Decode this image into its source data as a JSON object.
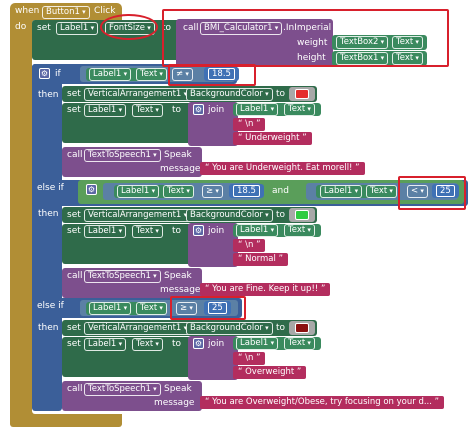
{
  "event": {
    "when": "when",
    "component": "Button1",
    "event": "Click",
    "do": "do"
  },
  "top_set": {
    "set": "set",
    "component": "Label1",
    "property": "FontSize",
    "to": "to",
    "call": "call",
    "method": "BMI_Calculator1",
    "method_name": ".InImperial",
    "weight_label": "weight",
    "height_label": "height",
    "weight_comp": "TextBox2",
    "weight_prop": "Text",
    "height_comp": "TextBox1",
    "height_prop": "Text"
  },
  "if1": {
    "if": "if",
    "then": "then",
    "comp": "Label1",
    "prop": "Text",
    "op": "≠",
    "value": "18.5",
    "bg_comp": "VerticalArrangement1",
    "bg_prop": "BackgroundColor",
    "bg_color": "#e52b2b",
    "join": "join",
    "join_comp": "Label1",
    "join_prop": "Text",
    "newline": "\\n",
    "word": "Underweight",
    "speak_comp": "TextToSpeech1",
    "speak": "Speak",
    "message_label": "message",
    "message": "You are Underweight. Eat morell!"
  },
  "elseif1": {
    "else_if": "else if",
    "then": "then",
    "and": "and",
    "comp_a": "Label1",
    "prop_a": "Text",
    "op_a": "≥",
    "value_a": "18.5",
    "comp_b": "Label1",
    "prop_b": "Text",
    "op_b": "<",
    "value_b": "25",
    "bg_comp": "VerticalArrangement1",
    "bg_prop": "BackgroundColor",
    "bg_color": "#2ecc40",
    "join": "join",
    "join_comp": "Label1",
    "join_prop": "Text",
    "newline": "\\n",
    "word": "Normal",
    "speak_comp": "TextToSpeech1",
    "speak": "Speak",
    "message_label": "message",
    "message": "You are Fine. Keep it up!!"
  },
  "elseif2": {
    "else_if": "else if",
    "then": "then",
    "comp": "Label1",
    "prop": "Text",
    "op": "≥",
    "value": "25",
    "bg_comp": "VerticalArrangement1",
    "bg_prop": "BackgroundColor",
    "bg_color": "#8b1010",
    "join": "join",
    "join_comp": "Label1",
    "join_prop": "Text",
    "newline": "\\n",
    "word": "Overweight",
    "speak_comp": "TextToSpeech1",
    "speak": "Speak",
    "message_label": "message",
    "message": "You are Overweight/Obese, try focusing on your d..."
  },
  "common": {
    "set": "set",
    "to": "to",
    "call": "call",
    "text_prop": "Text",
    "label": "Label1"
  }
}
